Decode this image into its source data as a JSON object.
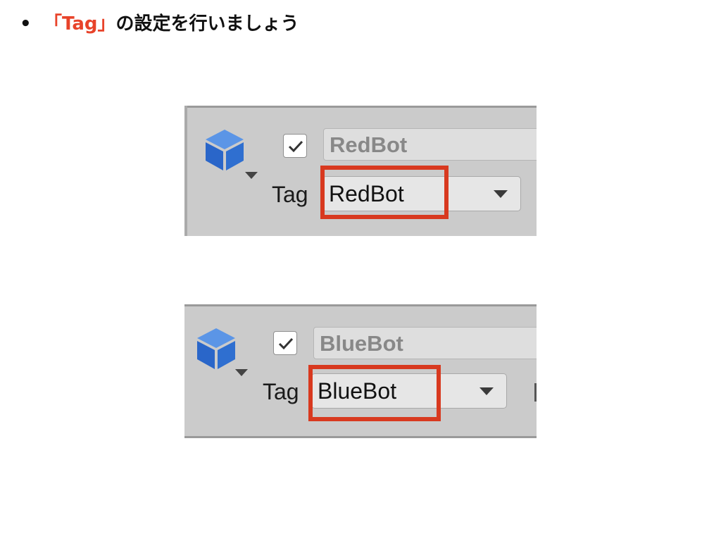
{
  "heading": {
    "bullet": "•",
    "accent": "「Tag」",
    "rest": "の設定を行いましょう"
  },
  "colors": {
    "accent": "#e8432a",
    "highlight_box": "#d8391f",
    "cube": "#2f6fd0",
    "panel_bg": "#cbcbcb"
  },
  "inspectors": [
    {
      "cube_icon": "cube-icon",
      "active_checked": true,
      "object_name": "RedBot",
      "tag_label": "Tag",
      "tag_value": "RedBot"
    },
    {
      "cube_icon": "cube-icon",
      "active_checked": true,
      "object_name": "BlueBot",
      "tag_label": "Tag",
      "tag_value": "BlueBot"
    }
  ]
}
